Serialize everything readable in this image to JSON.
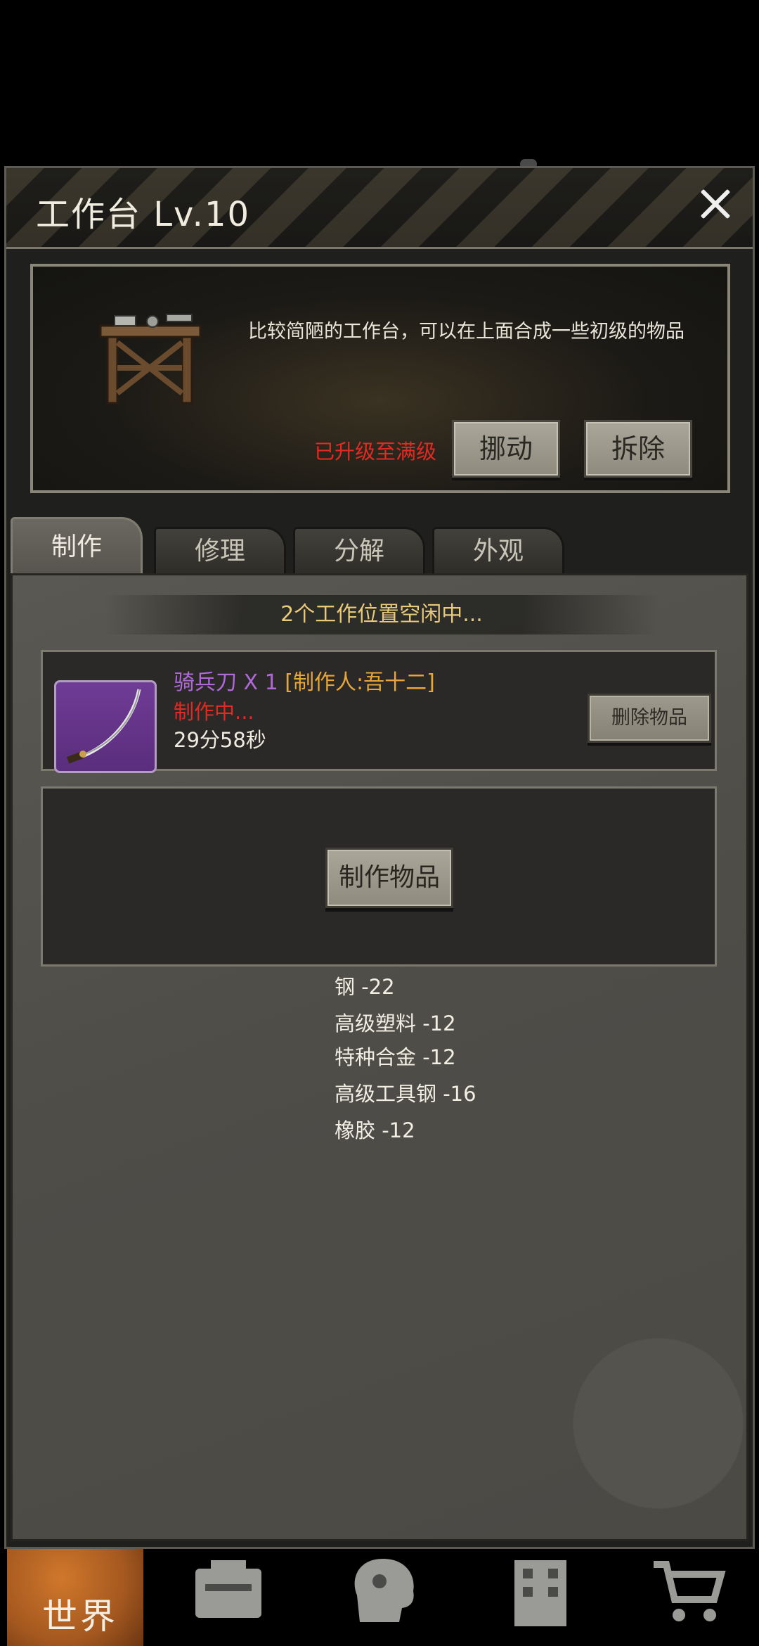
{
  "panel": {
    "title": "工作台 Lv.10",
    "description": "比较简陋的工作台，可以在上面合成一些初级的物品",
    "max_level_text": "已升级至满级",
    "move_label": "挪动",
    "remove_label": "拆除"
  },
  "tabs": [
    {
      "label": "制作",
      "active": true
    },
    {
      "label": "修理",
      "active": false
    },
    {
      "label": "分解",
      "active": false
    },
    {
      "label": "外观",
      "active": false
    }
  ],
  "craft": {
    "slots_text": "2个工作位置空闲中...",
    "job": {
      "item_name": "骑兵刀 X 1",
      "maker": "[制作人:吾十二]",
      "status": "制作中...",
      "time_left": "29分58秒",
      "delete_label": "删除物品"
    },
    "craft_button_label": "制作物品",
    "materials": [
      "钢 -22",
      "高级塑料 -12",
      "特种合金 -12",
      "高级工具钢 -16",
      "橡胶 -12"
    ]
  },
  "bottom_nav": {
    "world_label": "世界",
    "icons": [
      "backpack-icon",
      "head-icon",
      "building-icon",
      "cart-icon"
    ]
  },
  "colors": {
    "item_name": "#b06ad8",
    "maker": "#e7a63a",
    "status_red": "#e02a22",
    "slots_gold": "#e9c97a"
  }
}
